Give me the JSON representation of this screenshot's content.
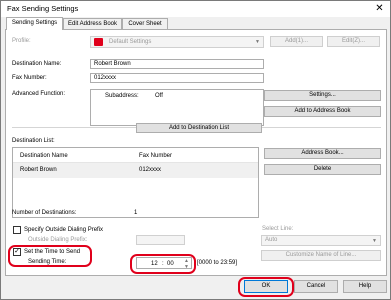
{
  "window": {
    "title": "Fax Sending Settings",
    "close_glyph": "✕"
  },
  "tabs": [
    {
      "label": "Sending Settings",
      "active": true
    },
    {
      "label": "Edit Address Book",
      "active": false
    },
    {
      "label": "Cover Sheet",
      "active": false
    }
  ],
  "profile": {
    "label": "Profile:",
    "value": "Default Settings",
    "add_label": "Add(1)...",
    "edit_label": "Edit(Z)..."
  },
  "destination": {
    "name_label": "Destination Name:",
    "name_value": "Robert Brown",
    "fax_label": "Fax Number:",
    "fax_value": "012xxxx",
    "advanced_label": "Advanced Function:",
    "subaddress_label": "Subaddress:",
    "subaddress_value": "Off",
    "settings_button": "Settings...",
    "add_to_book_button": "Add to Address Book",
    "add_to_list_button": "Add to Destination List"
  },
  "dest_list": {
    "label": "Destination List:",
    "columns": [
      "Destination Name",
      "Fax Number"
    ],
    "rows": [
      {
        "name": "Robert Brown",
        "fax": "012xxxx"
      }
    ],
    "address_book_button": "Address Book...",
    "delete_button": "Delete"
  },
  "count": {
    "label": "Number of Destinations:",
    "value": "1"
  },
  "dialing": {
    "prefix_checkbox_label": "Specify Outside Dialing Prefix",
    "prefix_checked": false,
    "prefix_field_label": "Outside Dialing Prefix:",
    "select_line_label": "Select Line:",
    "select_line_value": "Auto",
    "customize_button": "Customize Name of Line..."
  },
  "time": {
    "checkbox_label": "Set the Time to Send",
    "checked": true,
    "sending_time_label": "Sending Time:",
    "hour": "12",
    "separator": ":",
    "minute": "00",
    "range_text": "[0000 to 23:59]"
  },
  "footer": {
    "ok": "OK",
    "cancel": "Cancel",
    "help": "Help"
  },
  "colors": {
    "highlight": "#e0001b",
    "focus": "#0078d7"
  }
}
